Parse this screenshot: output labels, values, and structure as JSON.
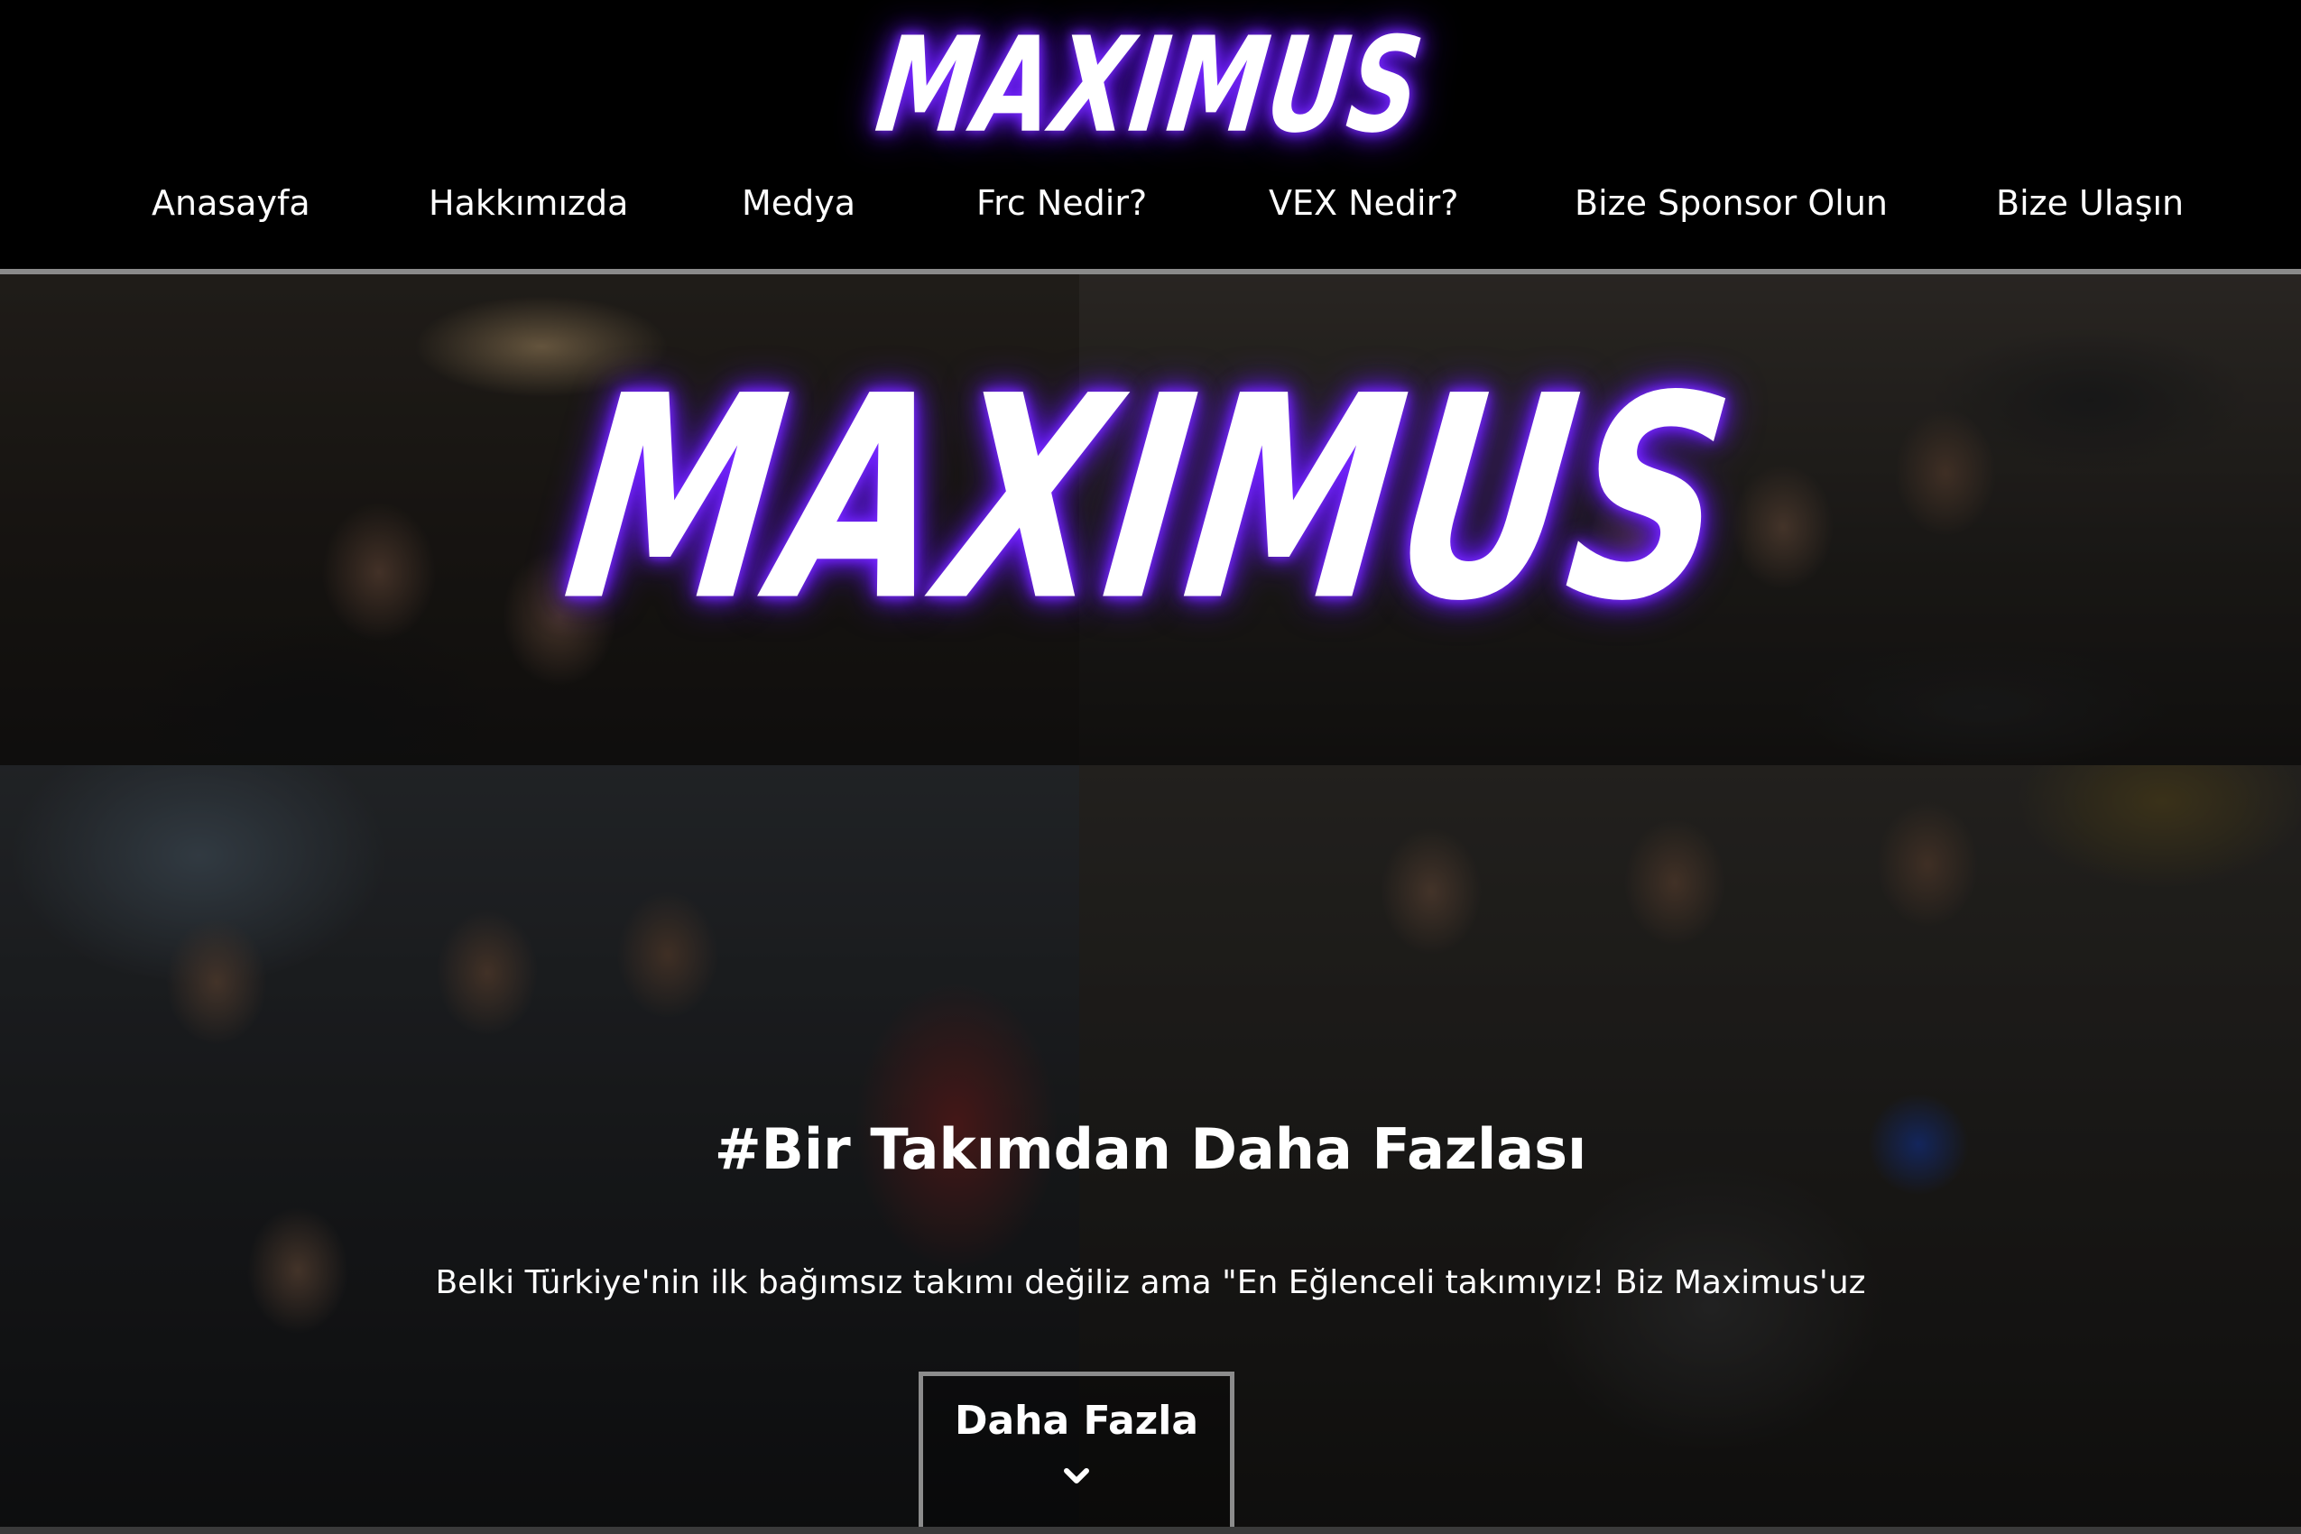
{
  "header": {
    "logo_text": "MAXIMUS",
    "nav": [
      {
        "label": "Anasayfa"
      },
      {
        "label": "Hakkımızda"
      },
      {
        "label": "Medya"
      },
      {
        "label": "Frc Nedir?"
      },
      {
        "label": "VEX Nedir?"
      },
      {
        "label": "Bize Sponsor Olun"
      },
      {
        "label": "Bize Ulaşın"
      }
    ]
  },
  "hero": {
    "logo_text": "MAXIMUS",
    "title": "#Bir Takımdan Daha Fazlası",
    "subtitle": "Belki Türkiye'nin ilk bağımsız takımı değiliz ama \"En Eğlenceli takımıyız! Biz Maximus'uz",
    "button_label": "Daha Fazla",
    "button_icon": "chevron-down-icon"
  },
  "colors": {
    "background": "#000000",
    "text": "#ffffff",
    "logo_glow": "#7b2cff",
    "button_border": "#8c8c8c"
  }
}
